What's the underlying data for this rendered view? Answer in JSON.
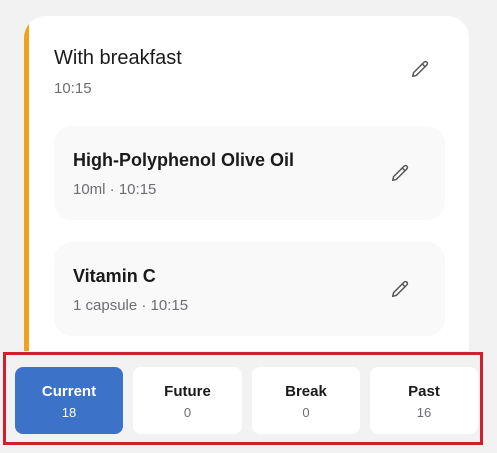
{
  "group": {
    "title": "With breakfast",
    "time": "10:15",
    "accent_color": "#f0a21a"
  },
  "items": [
    {
      "name": "High-Polyphenol Olive Oil",
      "detail": "10ml · 10:15"
    },
    {
      "name": "Vitamin C",
      "detail": "1 capsule · 10:15"
    }
  ],
  "icons": {
    "edit": "pencil-icon"
  },
  "tabs": [
    {
      "label": "Current",
      "count": "18",
      "active": true
    },
    {
      "label": "Future",
      "count": "0",
      "active": false
    },
    {
      "label": "Break",
      "count": "0",
      "active": false
    },
    {
      "label": "Past",
      "count": "16",
      "active": false
    }
  ],
  "colors": {
    "active_tab": "#3d72c9",
    "highlight_border": "#d0202c"
  }
}
